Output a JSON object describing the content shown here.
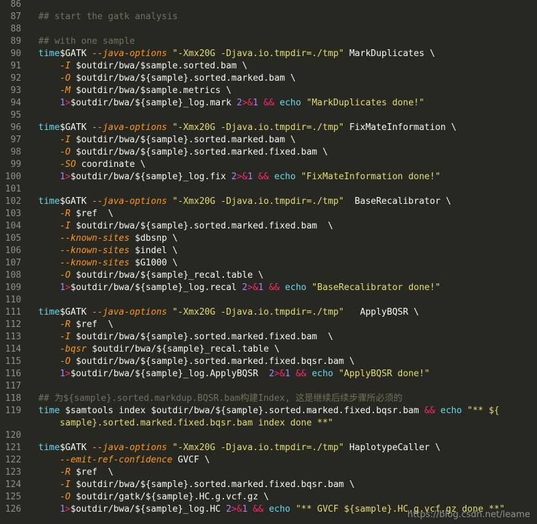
{
  "lines": [
    {
      "n": "86",
      "t": []
    },
    {
      "n": "87",
      "t": [
        [
          "c",
          "## start the gatk analysis"
        ]
      ]
    },
    {
      "n": "88",
      "t": []
    },
    {
      "n": "89",
      "t": [
        [
          "c",
          "## with one sample"
        ]
      ]
    },
    {
      "n": "90",
      "t": [
        [
          "k",
          "time"
        ],
        [
          "",
          "$GATK "
        ],
        [
          "o",
          "--java-options"
        ],
        [
          "",
          ""
        ],
        [
          "s",
          " \"-Xmx20G -Djava.io.tmpdir=./tmp\""
        ],
        [
          "",
          " MarkDuplicates \\"
        ]
      ]
    },
    {
      "n": "91",
      "t": [
        [
          "",
          "    "
        ],
        [
          "o",
          "-I"
        ],
        [
          "",
          " $outdir/bwa/$sample.sorted.bam \\"
        ]
      ]
    },
    {
      "n": "92",
      "t": [
        [
          "",
          "    "
        ],
        [
          "o",
          "-O"
        ],
        [
          "",
          " $outdir/bwa/${sample}.sorted.marked.bam \\"
        ]
      ]
    },
    {
      "n": "93",
      "t": [
        [
          "",
          "    "
        ],
        [
          "o",
          "-M"
        ],
        [
          "",
          " $outdir/bwa/$sample.metrics \\"
        ]
      ]
    },
    {
      "n": "94",
      "t": [
        [
          "",
          "    "
        ],
        [
          "r",
          "1"
        ],
        [
          "p",
          ">"
        ],
        [
          "",
          "$outdir/bwa/${sample}_log.mark "
        ],
        [
          "r",
          "2"
        ],
        [
          "p",
          ">&"
        ],
        [
          "r",
          "1"
        ],
        [
          "",
          " "
        ],
        [
          "p",
          "&&"
        ],
        [
          "",
          " "
        ],
        [
          "k",
          "echo"
        ],
        [
          "s",
          " \"MarkDuplicates done!\""
        ]
      ]
    },
    {
      "n": "95",
      "t": []
    },
    {
      "n": "96",
      "t": [
        [
          "k",
          "time"
        ],
        [
          "",
          "$GATK "
        ],
        [
          "o",
          "--java-options"
        ],
        [
          "s",
          " \"-Xmx20G -Djava.io.tmpdir=./tmp\""
        ],
        [
          "",
          " FixMateInformation \\"
        ]
      ]
    },
    {
      "n": "97",
      "t": [
        [
          "",
          "    "
        ],
        [
          "o",
          "-I"
        ],
        [
          "",
          " $outdir/bwa/${sample}.sorted.marked.bam \\"
        ]
      ]
    },
    {
      "n": "98",
      "t": [
        [
          "",
          "    "
        ],
        [
          "o",
          "-O"
        ],
        [
          "",
          " $outdir/bwa/${sample}.sorted.marked.fixed.bam \\"
        ]
      ]
    },
    {
      "n": "99",
      "t": [
        [
          "",
          "    "
        ],
        [
          "o",
          "-SO"
        ],
        [
          "",
          " coordinate \\"
        ]
      ]
    },
    {
      "n": "100",
      "t": [
        [
          "",
          "    "
        ],
        [
          "r",
          "1"
        ],
        [
          "p",
          ">"
        ],
        [
          "",
          "$outdir/bwa/${sample}_log.fix "
        ],
        [
          "r",
          "2"
        ],
        [
          "p",
          ">&"
        ],
        [
          "r",
          "1"
        ],
        [
          "",
          " "
        ],
        [
          "p",
          "&&"
        ],
        [
          "",
          " "
        ],
        [
          "k",
          "echo"
        ],
        [
          "s",
          " \"FixMateInformation done!\""
        ]
      ]
    },
    {
      "n": "101",
      "t": []
    },
    {
      "n": "102",
      "t": [
        [
          "k",
          "time"
        ],
        [
          "",
          "$GATK "
        ],
        [
          "o",
          "--java-options"
        ],
        [
          "s",
          " \"-Xmx20G -Djava.io.tmpdir=./tmp\""
        ],
        [
          "",
          "  BaseRecalibrator \\"
        ]
      ]
    },
    {
      "n": "103",
      "t": [
        [
          "",
          "    "
        ],
        [
          "o",
          "-R"
        ],
        [
          "",
          " $ref  \\"
        ]
      ]
    },
    {
      "n": "104",
      "t": [
        [
          "",
          "    "
        ],
        [
          "o",
          "-I"
        ],
        [
          "",
          " $outdir/bwa/${sample}.sorted.marked.fixed.bam  \\"
        ]
      ]
    },
    {
      "n": "105",
      "t": [
        [
          "",
          "    "
        ],
        [
          "o",
          "--known-sites"
        ],
        [
          "",
          " $dbsnp \\"
        ]
      ]
    },
    {
      "n": "106",
      "t": [
        [
          "",
          "    "
        ],
        [
          "o",
          "--known-sites"
        ],
        [
          "",
          " $indel \\"
        ]
      ]
    },
    {
      "n": "107",
      "t": [
        [
          "",
          "    "
        ],
        [
          "o",
          "--known-sites"
        ],
        [
          "",
          " $G1000 \\"
        ]
      ]
    },
    {
      "n": "108",
      "t": [
        [
          "",
          "    "
        ],
        [
          "o",
          "-O"
        ],
        [
          "",
          " $outdir/bwa/${sample}_recal.table \\"
        ]
      ]
    },
    {
      "n": "109",
      "t": [
        [
          "",
          "    "
        ],
        [
          "r",
          "1"
        ],
        [
          "p",
          ">"
        ],
        [
          "",
          "$outdir/bwa/${sample}_log.recal "
        ],
        [
          "r",
          "2"
        ],
        [
          "p",
          ">&"
        ],
        [
          "r",
          "1"
        ],
        [
          "",
          " "
        ],
        [
          "p",
          "&&"
        ],
        [
          "",
          " "
        ],
        [
          "k",
          "echo"
        ],
        [
          "s",
          " \"BaseRecalibrator done!\""
        ]
      ]
    },
    {
      "n": "110",
      "t": []
    },
    {
      "n": "111",
      "t": [
        [
          "k",
          "time"
        ],
        [
          "",
          "$GATK "
        ],
        [
          "o",
          "--java-options"
        ],
        [
          "s",
          " \"-Xmx20G -Djava.io.tmpdir=./tmp\""
        ],
        [
          "",
          "   ApplyBQSR \\"
        ]
      ]
    },
    {
      "n": "112",
      "t": [
        [
          "",
          "    "
        ],
        [
          "o",
          "-R"
        ],
        [
          "",
          " $ref  \\"
        ]
      ]
    },
    {
      "n": "113",
      "t": [
        [
          "",
          "    "
        ],
        [
          "o",
          "-I"
        ],
        [
          "",
          " $outdir/bwa/${sample}.sorted.marked.fixed.bam  \\"
        ]
      ]
    },
    {
      "n": "114",
      "t": [
        [
          "",
          "    "
        ],
        [
          "o",
          "-bqsr"
        ],
        [
          "",
          " $outdir/bwa/${sample}_recal.table \\"
        ]
      ]
    },
    {
      "n": "115",
      "t": [
        [
          "",
          "    "
        ],
        [
          "o",
          "-O"
        ],
        [
          "",
          " $outdir/bwa/${sample}.sorted.marked.fixed.bqsr.bam \\"
        ]
      ]
    },
    {
      "n": "116",
      "t": [
        [
          "",
          "    "
        ],
        [
          "r",
          "1"
        ],
        [
          "p",
          ">"
        ],
        [
          "",
          "$outdir/bwa/${sample}_log.ApplyBQSR  "
        ],
        [
          "r",
          "2"
        ],
        [
          "p",
          ">&"
        ],
        [
          "r",
          "1"
        ],
        [
          "",
          " "
        ],
        [
          "p",
          "&&"
        ],
        [
          "",
          " "
        ],
        [
          "k",
          "echo"
        ],
        [
          "s",
          " \"ApplyBQSR done!\""
        ]
      ]
    },
    {
      "n": "117",
      "t": []
    },
    {
      "n": "118",
      "t": [
        [
          "c",
          "## 为${sample}.sorted.markdup.BQSR.bam构建Index, 这是继续后续步骤所必须的"
        ]
      ]
    },
    {
      "n": "119",
      "t": [
        [
          "k",
          "time"
        ],
        [
          "",
          " $samtools index $outdir/bwa/${sample}.sorted.marked.fixed.bqsr.bam "
        ],
        [
          "p",
          "&&"
        ],
        [
          "",
          " "
        ],
        [
          "k",
          "echo"
        ],
        [
          "s",
          " \"** ${"
        ]
      ]
    },
    {
      "n": "",
      "t": [
        [
          "s",
          "    sample}.sorted.marked.fixed.bqsr.bam index done **\""
        ]
      ]
    },
    {
      "n": "120",
      "t": []
    },
    {
      "n": "121",
      "t": [
        [
          "k",
          "time"
        ],
        [
          "",
          "$GATK "
        ],
        [
          "o",
          "--java-options"
        ],
        [
          "s",
          " \"-Xmx20G -Djava.io.tmpdir=./tmp\""
        ],
        [
          "",
          " HaplotypeCaller \\"
        ]
      ]
    },
    {
      "n": "122",
      "t": [
        [
          "",
          "    "
        ],
        [
          "o",
          "--emit-ref-confidence"
        ],
        [
          "",
          " GVCF \\"
        ]
      ]
    },
    {
      "n": "123",
      "t": [
        [
          "",
          "    "
        ],
        [
          "o",
          "-R"
        ],
        [
          "",
          " $ref  \\"
        ]
      ]
    },
    {
      "n": "124",
      "t": [
        [
          "",
          "    "
        ],
        [
          "o",
          "-I"
        ],
        [
          "",
          " $outdir/bwa/${sample}.sorted.marked.fixed.bqsr.bam \\"
        ]
      ]
    },
    {
      "n": "125",
      "t": [
        [
          "",
          "    "
        ],
        [
          "o",
          "-O"
        ],
        [
          "",
          " $outdir/gatk/${sample}.HC.g.vcf.gz \\"
        ]
      ]
    },
    {
      "n": "126",
      "t": [
        [
          "",
          "    "
        ],
        [
          "r",
          "1"
        ],
        [
          "p",
          ">"
        ],
        [
          "",
          "$outdir/bwa/${sample}_log.HC "
        ],
        [
          "r",
          "2"
        ],
        [
          "p",
          ">&"
        ],
        [
          "r",
          "1"
        ],
        [
          "",
          " "
        ],
        [
          "p",
          "&&"
        ],
        [
          "",
          " "
        ],
        [
          "k",
          "echo"
        ],
        [
          "s",
          " \"** GVCF ${sample}.HC.g.vcf.gz done **\""
        ]
      ]
    }
  ],
  "watermark": "https://blog.csdn.net/leame"
}
